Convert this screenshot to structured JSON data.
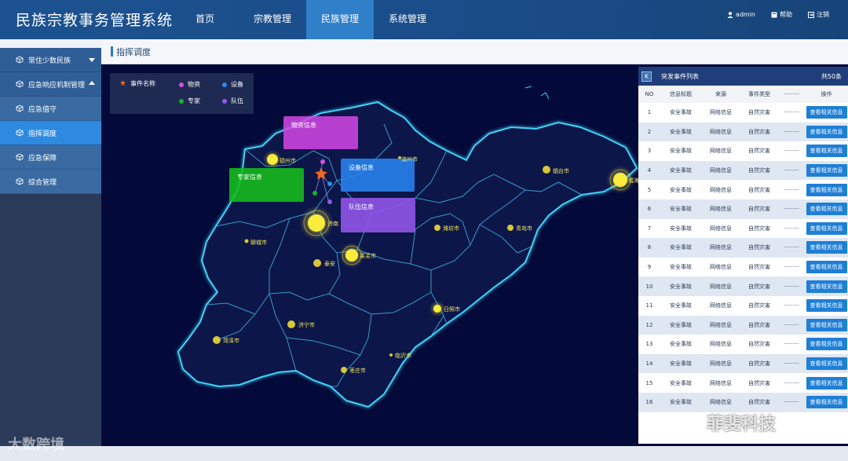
{
  "header": {
    "title": "民族宗教事务管理系统",
    "nav": [
      {
        "label": "首页",
        "active": false
      },
      {
        "label": "宗教管理",
        "active": false
      },
      {
        "label": "民族管理",
        "active": true
      },
      {
        "label": "系统管理",
        "active": false
      }
    ],
    "user": "admin",
    "help": "帮助",
    "logout": "注销"
  },
  "sidebar": {
    "items": [
      {
        "label": "常住少数民族",
        "type": "top",
        "icon": "cube-icon",
        "arrow": "down"
      },
      {
        "label": "应急响应机制管理",
        "type": "top",
        "icon": "cube-icon",
        "arrow": "up"
      },
      {
        "label": "应急值守",
        "type": "sub",
        "icon": "cube-icon"
      },
      {
        "label": "指挥调度",
        "type": "sub",
        "icon": "cube-icon",
        "active": true
      },
      {
        "label": "应急保障",
        "type": "sub",
        "icon": "cube-icon"
      },
      {
        "label": "综合管理",
        "type": "sub",
        "icon": "cube-icon"
      }
    ]
  },
  "breadcrumb": "指挥调度",
  "legend": {
    "event": "事件名称",
    "materials": "物资",
    "equipment": "设备",
    "experts": "专家",
    "team": "队伍",
    "colors": {
      "event": "#f06624",
      "materials": "#d44fe3",
      "equipment": "#2c8cf0",
      "experts": "#1bb02a",
      "team": "#9257ea"
    }
  },
  "popups": {
    "materials": "物资信息",
    "equipment": "设备信息",
    "experts": "专家信息",
    "team": "队伍信息"
  },
  "cities": {
    "dezhou": "德州市",
    "binzhou": "滨州市",
    "yantai": "烟台市",
    "weihai": "威海",
    "jinan": "济南",
    "liaocheng": "聊城市",
    "weifang": "潍坊市",
    "qingdao": "青岛市",
    "laiwu": "莱芜市",
    "taian": "泰安",
    "rizhao": "日照市",
    "jining": "济宁市",
    "heze": "菏泽市",
    "linyi": "临沂市",
    "zaozhuang": "枣庄市"
  },
  "panel": {
    "title": "突发事件列表",
    "total": "共50条",
    "columns": [
      "NO",
      "信息标题",
      "来源",
      "事件类型",
      "·········",
      "操作"
    ],
    "rows": [
      {
        "no": "1",
        "title": "安全事故",
        "source": "网络信息",
        "type": "自然灾害",
        "more": "·········",
        "action": "查看相关信息"
      },
      {
        "no": "2",
        "title": "安全事故",
        "source": "网络信息",
        "type": "自然灾害",
        "more": "·········",
        "action": "查看相关信息"
      },
      {
        "no": "3",
        "title": "安全事故",
        "source": "网络信息",
        "type": "自然灾害",
        "more": "·········",
        "action": "查看相关信息"
      },
      {
        "no": "4",
        "title": "安全事故",
        "source": "网络信息",
        "type": "自然灾害",
        "more": "·········",
        "action": "查看相关信息"
      },
      {
        "no": "5",
        "title": "安全事故",
        "source": "网络信息",
        "type": "自然灾害",
        "more": "·········",
        "action": "查看相关信息"
      },
      {
        "no": "6",
        "title": "安全事故",
        "source": "网络信息",
        "type": "自然灾害",
        "more": "·········",
        "action": "查看相关信息"
      },
      {
        "no": "7",
        "title": "安全事故",
        "source": "网络信息",
        "type": "自然灾害",
        "more": "·········",
        "action": "查看相关信息"
      },
      {
        "no": "8",
        "title": "安全事故",
        "source": "网络信息",
        "type": "自然灾害",
        "more": "·········",
        "action": "查看相关信息"
      },
      {
        "no": "9",
        "title": "安全事故",
        "source": "网络信息",
        "type": "自然灾害",
        "more": "·········",
        "action": "查看相关信息"
      },
      {
        "no": "10",
        "title": "安全事故",
        "source": "网络信息",
        "type": "自然灾害",
        "more": "·········",
        "action": "查看相关信息"
      },
      {
        "no": "11",
        "title": "安全事故",
        "source": "网络信息",
        "type": "自然灾害",
        "more": "·········",
        "action": "查看相关信息"
      },
      {
        "no": "12",
        "title": "安全事故",
        "source": "网络信息",
        "type": "自然灾害",
        "more": "·········",
        "action": "查看相关信息"
      },
      {
        "no": "13",
        "title": "安全事故",
        "source": "网络信息",
        "type": "自然灾害",
        "more": "·········",
        "action": "查看相关信息"
      },
      {
        "no": "14",
        "title": "安全事故",
        "source": "网络信息",
        "type": "自然灾害",
        "more": "·········",
        "action": "查看相关信息"
      },
      {
        "no": "15",
        "title": "安全事故",
        "source": "网络信息",
        "type": "自然灾害",
        "more": "·········",
        "action": "查看相关信息"
      },
      {
        "no": "16",
        "title": "安全事故",
        "source": "网络信息",
        "type": "自然灾害",
        "more": "·········",
        "action": "查看相关信息"
      }
    ]
  },
  "watermarks": {
    "left": "大数跨境",
    "right": "菲斐科技"
  }
}
